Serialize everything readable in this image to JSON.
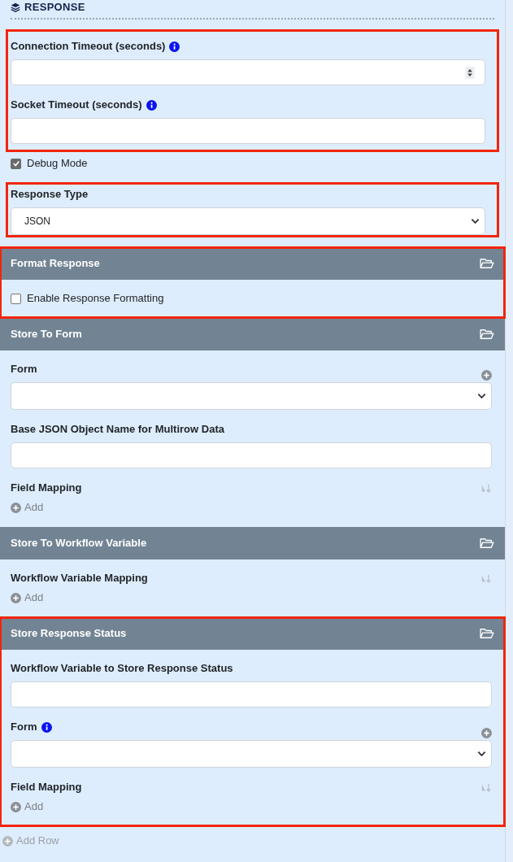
{
  "section_title": "RESPONSE",
  "blocks": [
    {
      "kind": "group",
      "highlighted": true,
      "items": [
        {
          "kind": "number",
          "label": "Connection Timeout (seconds)",
          "info": true
        },
        {
          "kind": "text",
          "label": "Socket Timeout (seconds)",
          "info": true
        }
      ]
    },
    {
      "kind": "group",
      "highlighted": false,
      "items": [
        {
          "kind": "checkbox",
          "label": "Debug Mode",
          "checked": true
        }
      ]
    },
    {
      "kind": "group",
      "highlighted": true,
      "items": [
        {
          "kind": "select",
          "label": "Response Type",
          "value": "JSON"
        }
      ]
    },
    {
      "kind": "panel",
      "title": "Format Response",
      "highlighted": true,
      "items": [
        {
          "kind": "checkbox",
          "label": "Enable Response Formatting",
          "checked": false
        }
      ]
    },
    {
      "kind": "panel",
      "title": "Store To Form",
      "highlighted": false,
      "items": [
        {
          "kind": "select",
          "label": "Form",
          "add_icon": true
        },
        {
          "kind": "text",
          "label": "Base JSON Object Name for Multirow Data"
        },
        {
          "kind": "mapping",
          "label": "Field Mapping",
          "add_label": "Add"
        }
      ]
    },
    {
      "kind": "panel",
      "title": "Store To Workflow Variable",
      "highlighted": false,
      "items": [
        {
          "kind": "mapping",
          "label": "Workflow Variable Mapping",
          "add_label": "Add"
        }
      ]
    },
    {
      "kind": "panel",
      "title": "Store Response Status",
      "highlighted": true,
      "items": [
        {
          "kind": "text",
          "label": "Workflow Variable to Store Response Status"
        },
        {
          "kind": "select",
          "label": "Form",
          "info": true,
          "add_icon": true
        },
        {
          "kind": "mapping",
          "label": "Field Mapping",
          "add_label": "Add"
        }
      ]
    }
  ],
  "footer_link": "Add Row"
}
